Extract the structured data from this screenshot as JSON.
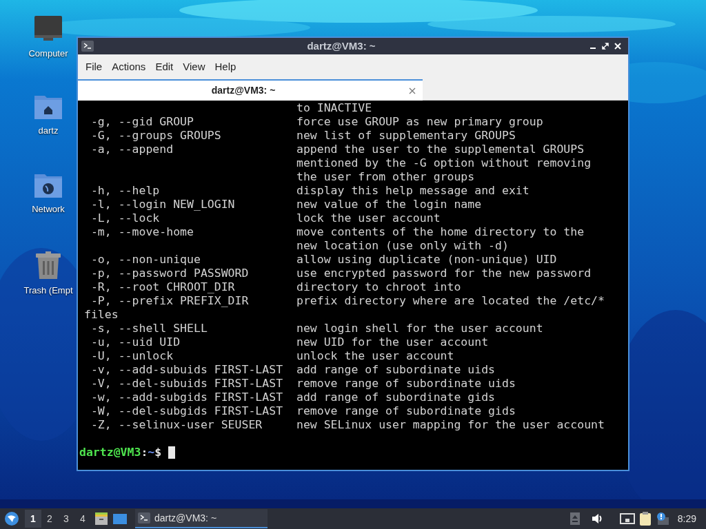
{
  "desktop_icons": [
    {
      "label": "Computer",
      "kind": "computer"
    },
    {
      "label": "dartz",
      "kind": "home"
    },
    {
      "label": "Network",
      "kind": "network"
    },
    {
      "label": "Trash (Empt",
      "kind": "trash"
    }
  ],
  "window": {
    "title": "dartz@VM3: ~",
    "menu": [
      "File",
      "Actions",
      "Edit",
      "View",
      "Help"
    ],
    "tabs": [
      {
        "label": "dartz@VM3: ~",
        "selected": true
      }
    ],
    "terminal": {
      "lines": [
        "                               to INACTIVE",
        " -g, --gid GROUP               force use GROUP as new primary group",
        " -G, --groups GROUPS           new list of supplementary GROUPS",
        " -a, --append                  append the user to the supplemental GROUPS",
        "                               mentioned by the -G option without removing",
        "                               the user from other groups",
        " -h, --help                    display this help message and exit",
        " -l, --login NEW_LOGIN         new value of the login name",
        " -L, --lock                    lock the user account",
        " -m, --move-home               move contents of the home directory to the",
        "                               new location (use only with -d)",
        " -o, --non-unique              allow using duplicate (non-unique) UID",
        " -p, --password PASSWORD       use encrypted password for the new password",
        " -R, --root CHROOT_DIR         directory to chroot into",
        " -P, --prefix PREFIX_DIR       prefix directory where are located the /etc/*",
        "files",
        " -s, --shell SHELL             new login shell for the user account",
        " -u, --uid UID                 new UID for the user account",
        " -U, --unlock                  unlock the user account",
        " -v, --add-subuids FIRST-LAST  add range of subordinate uids",
        " -V, --del-subuids FIRST-LAST  remove range of subordinate uids",
        " -w, --add-subgids FIRST-LAST  add range of subordinate gids",
        " -W, --del-subgids FIRST-LAST  remove range of subordinate gids",
        " -Z, --selinux-user SEUSER     new SELinux user mapping for the user account"
      ],
      "prompt": {
        "user_host": "dartz@VM3",
        "separator": ":",
        "path": "~",
        "symbol": "$"
      }
    }
  },
  "taskbar": {
    "workspaces": [
      {
        "label": "1",
        "selected": true
      },
      {
        "label": "2",
        "selected": false
      },
      {
        "label": "3",
        "selected": false
      },
      {
        "label": "4",
        "selected": false
      }
    ],
    "tasks": [
      {
        "label": "dartz@VM3: ~",
        "selected": true
      }
    ],
    "clock": "8:29"
  }
}
